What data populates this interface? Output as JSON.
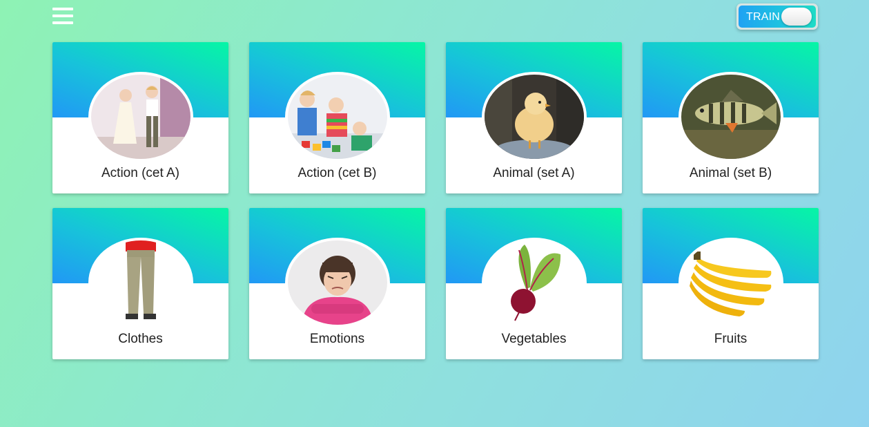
{
  "toolbar": {
    "menu_icon": "hamburger-menu-icon",
    "train_label": "TRAIN",
    "train_toggle_state": "off",
    "train_toggle_color": "#1fa2f3"
  },
  "colors": {
    "background_start": "#8ef2b4",
    "background_end": "#8fd3ee",
    "card_header_start": "#2198f5",
    "card_header_end": "#06f6a5"
  },
  "categories": [
    {
      "label": "Action (cet A)",
      "image": "children-dancing"
    },
    {
      "label": "Action (cet B)",
      "image": "children-playing-blocks"
    },
    {
      "label": "Animal (set A)",
      "image": "chick"
    },
    {
      "label": "Animal (set B)",
      "image": "fish"
    },
    {
      "label": "Clothes",
      "image": "trousers"
    },
    {
      "label": "Emotions",
      "image": "angry-girl"
    },
    {
      "label": "Vegetables",
      "image": "beetroot"
    },
    {
      "label": "Fruits",
      "image": "bananas"
    }
  ]
}
